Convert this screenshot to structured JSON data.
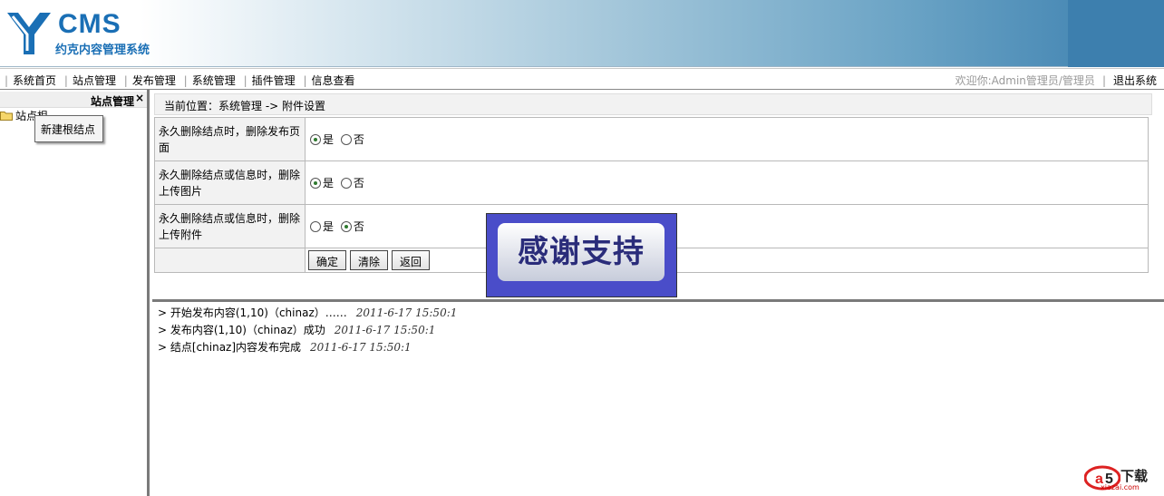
{
  "header": {
    "logo_text": "CMS",
    "logo_subtitle": "约克内容管理系统"
  },
  "nav": {
    "items": [
      "系统首页",
      "站点管理",
      "发布管理",
      "系统管理",
      "插件管理",
      "信息查看"
    ],
    "welcome": "欢迎你:Admin管理员/管理员",
    "logout": "退出系统"
  },
  "sidebar": {
    "title": "站点管理",
    "close": "×",
    "tree_root": "站点根",
    "context_menu": "新建根结点"
  },
  "breadcrumb": "当前位置：系统管理 -> 附件设置",
  "settings": [
    {
      "label": "永久删除结点时，删除发布页面",
      "yes": "是",
      "no": "否",
      "selected": "yes"
    },
    {
      "label": "永久删除结点或信息时，删除上传图片",
      "yes": "是",
      "no": "否",
      "selected": "yes"
    },
    {
      "label": "永久删除结点或信息时，删除上传附件",
      "yes": "是",
      "no": "否",
      "selected": "no"
    }
  ],
  "buttons": {
    "confirm": "确定",
    "clear": "清除",
    "back": "返回"
  },
  "log": [
    {
      "text": "> 开始发布内容(1,10)（chinaz）……",
      "time": "2011-6-17 15:50:1"
    },
    {
      "text": "> 发布内容(1,10)（chinaz）成功",
      "time": "2011-6-17 15:50:1"
    },
    {
      "text": "> 结点[chinaz]内容发布完成",
      "time": "2011-6-17 15:50:1"
    }
  ],
  "overlay": {
    "text": "感谢支持"
  },
  "watermark": {
    "brand": "下载",
    "site": "xiazai.com"
  },
  "colors": {
    "brand": "#1a6fb5",
    "overlay_bg": "#4a4dc9"
  }
}
